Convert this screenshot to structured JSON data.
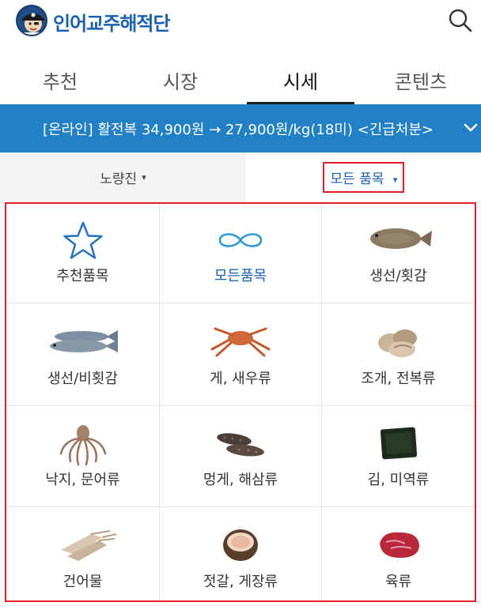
{
  "header": {
    "brand": "인어교주해적단",
    "logo_icon": "pirate-mascot-icon",
    "search_icon": "search-icon"
  },
  "tabs": [
    {
      "label": "추천",
      "active": false
    },
    {
      "label": "시장",
      "active": false
    },
    {
      "label": "시세",
      "active": true
    },
    {
      "label": "콘텐츠",
      "active": false
    }
  ],
  "banner": {
    "text": "[온라인] 활전복 34,900원 → 27,900원/kg(18미) <긴급처분>",
    "chevron_icon": "chevron-down-icon",
    "color": "#2280c7"
  },
  "filter": {
    "market": "노량진",
    "category": "모든 품목",
    "caret": "▾"
  },
  "categories": [
    {
      "label": "추천품목",
      "icon": "star-icon"
    },
    {
      "label": "모든품목",
      "icon": "infinity-icon",
      "selected": true
    },
    {
      "label": "생선/횟감",
      "icon": "flatfish-icon"
    },
    {
      "label": "생선/비횟감",
      "icon": "mackerel-icon"
    },
    {
      "label": "게, 새우류",
      "icon": "crab-icon"
    },
    {
      "label": "조개, 전복류",
      "icon": "clam-icon"
    },
    {
      "label": "낙지, 문어류",
      "icon": "octopus-icon"
    },
    {
      "label": "멍게, 해삼류",
      "icon": "sea-cucumber-icon"
    },
    {
      "label": "김, 미역류",
      "icon": "seaweed-icon"
    },
    {
      "label": "건어물",
      "icon": "dried-squid-icon"
    },
    {
      "label": "젓갈, 게장류",
      "icon": "salted-seafood-icon"
    },
    {
      "label": "육류",
      "icon": "meat-icon"
    }
  ],
  "colors": {
    "accent_blue": "#1a5fb0",
    "highlight_red": "#e01e27"
  }
}
